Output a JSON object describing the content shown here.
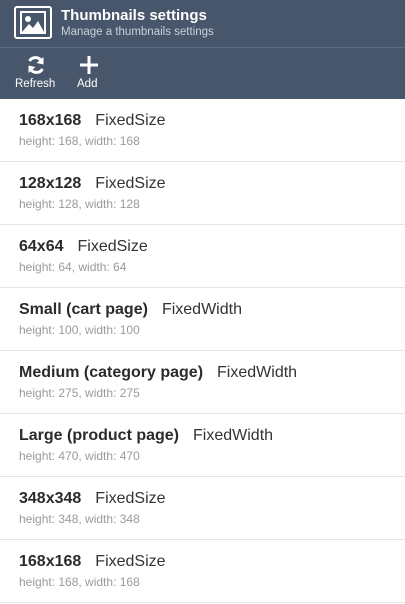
{
  "header": {
    "title": "Thumbnails settings",
    "subtitle": "Manage a thumbnails settings",
    "icon": "image-icon",
    "background_color": "#47566a"
  },
  "toolbar": {
    "refresh_label": "Refresh",
    "add_label": "Add"
  },
  "items": [
    {
      "name": "168x168",
      "type": "FixedSize",
      "details": "height: 168, width: 168"
    },
    {
      "name": "128x128",
      "type": "FixedSize",
      "details": "height: 128, width: 128"
    },
    {
      "name": "64x64",
      "type": "FixedSize",
      "details": "height: 64, width: 64"
    },
    {
      "name": "Small (cart page)",
      "type": "FixedWidth",
      "details": "height: 100, width: 100"
    },
    {
      "name": "Medium (category page)",
      "type": "FixedWidth",
      "details": "height: 275, width: 275"
    },
    {
      "name": "Large (product page)",
      "type": "FixedWidth",
      "details": "height: 470, width: 470"
    },
    {
      "name": "348x348",
      "type": "FixedSize",
      "details": "height: 348, width: 348"
    },
    {
      "name": "168x168",
      "type": "FixedSize",
      "details": "height: 168, width: 168"
    }
  ]
}
